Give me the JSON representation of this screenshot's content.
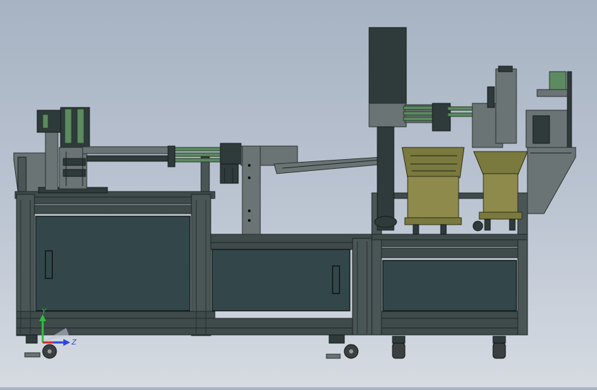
{
  "viewport": {
    "background_top": "#a7b3c3",
    "background_bottom": "#d6dbe2"
  },
  "axis_triad": {
    "y_label": "Y",
    "z_label": "Z",
    "y_color": "#2fbf3b",
    "z_color": "#2e46d8",
    "x_color": "#d42828"
  },
  "colors": {
    "frame": "#3f4a4b",
    "panel": "#33474a",
    "cylinder_green": "#5d8a61",
    "bowl_feeder": "#7a7a3e"
  }
}
